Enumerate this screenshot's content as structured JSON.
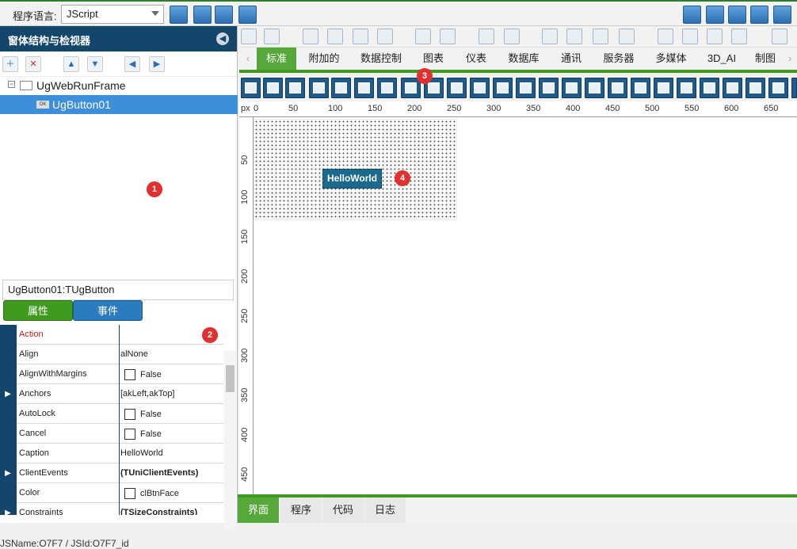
{
  "topbar": {
    "lang_label": "程序语言:",
    "lang_value": "JScript"
  },
  "left_panel": {
    "title": "窗体结构与检视器",
    "tree": {
      "root": "UgWebRunFrame",
      "child": "UgButton01",
      "child_icon_text": "OK"
    },
    "object_name": "UgButton01:TUgButton",
    "tabs": {
      "properties": "属性",
      "events": "事件"
    },
    "properties": [
      {
        "name": "Action",
        "value": "",
        "checkbox": false,
        "expand": false,
        "highlight": true
      },
      {
        "name": "Align",
        "value": "alNone",
        "checkbox": false,
        "expand": false
      },
      {
        "name": "AlignWithMargins",
        "value": "False",
        "checkbox": true,
        "expand": false
      },
      {
        "name": "Anchors",
        "value": "[akLeft,akTop]",
        "checkbox": false,
        "expand": true
      },
      {
        "name": "AutoLock",
        "value": "False",
        "checkbox": true,
        "expand": false
      },
      {
        "name": "Cancel",
        "value": "False",
        "checkbox": true,
        "expand": false
      },
      {
        "name": "Caption",
        "value": "HelloWorld",
        "checkbox": false,
        "expand": false
      },
      {
        "name": "ClientEvents",
        "value": "(TUniClientEvents)",
        "checkbox": false,
        "expand": true,
        "bold": true
      },
      {
        "name": "Color",
        "value": "clBtnFace",
        "checkbox": true,
        "expand": false
      },
      {
        "name": "Constraints",
        "value": "(TSizeConstraints)",
        "checkbox": false,
        "expand": true,
        "bold": true
      }
    ],
    "status": "JSName:O7F7 / JSId:O7F7_id"
  },
  "designer": {
    "tabs": [
      "标准",
      "附加的",
      "数据控制",
      "图表",
      "仪表",
      "数据库",
      "通讯",
      "服务器",
      "多媒体",
      "3D_AI",
      "制图"
    ],
    "ruler_unit": "px",
    "h_ticks": [
      "0",
      "50",
      "100",
      "150",
      "200",
      "250",
      "300",
      "350",
      "400",
      "450",
      "500",
      "550",
      "600",
      "650"
    ],
    "v_ticks": [
      "50",
      "100",
      "150",
      "200",
      "250",
      "300",
      "350",
      "400",
      "450"
    ],
    "button_caption": "HelloWorld",
    "bottom_tabs": [
      "界面",
      "程序",
      "代码",
      "日志"
    ]
  },
  "badges": [
    "1",
    "2",
    "3",
    "4"
  ],
  "colors": {
    "header": "#14466b",
    "accent": "#3f9a20",
    "selected": "#3d8fdc",
    "badge": "#e03030"
  }
}
